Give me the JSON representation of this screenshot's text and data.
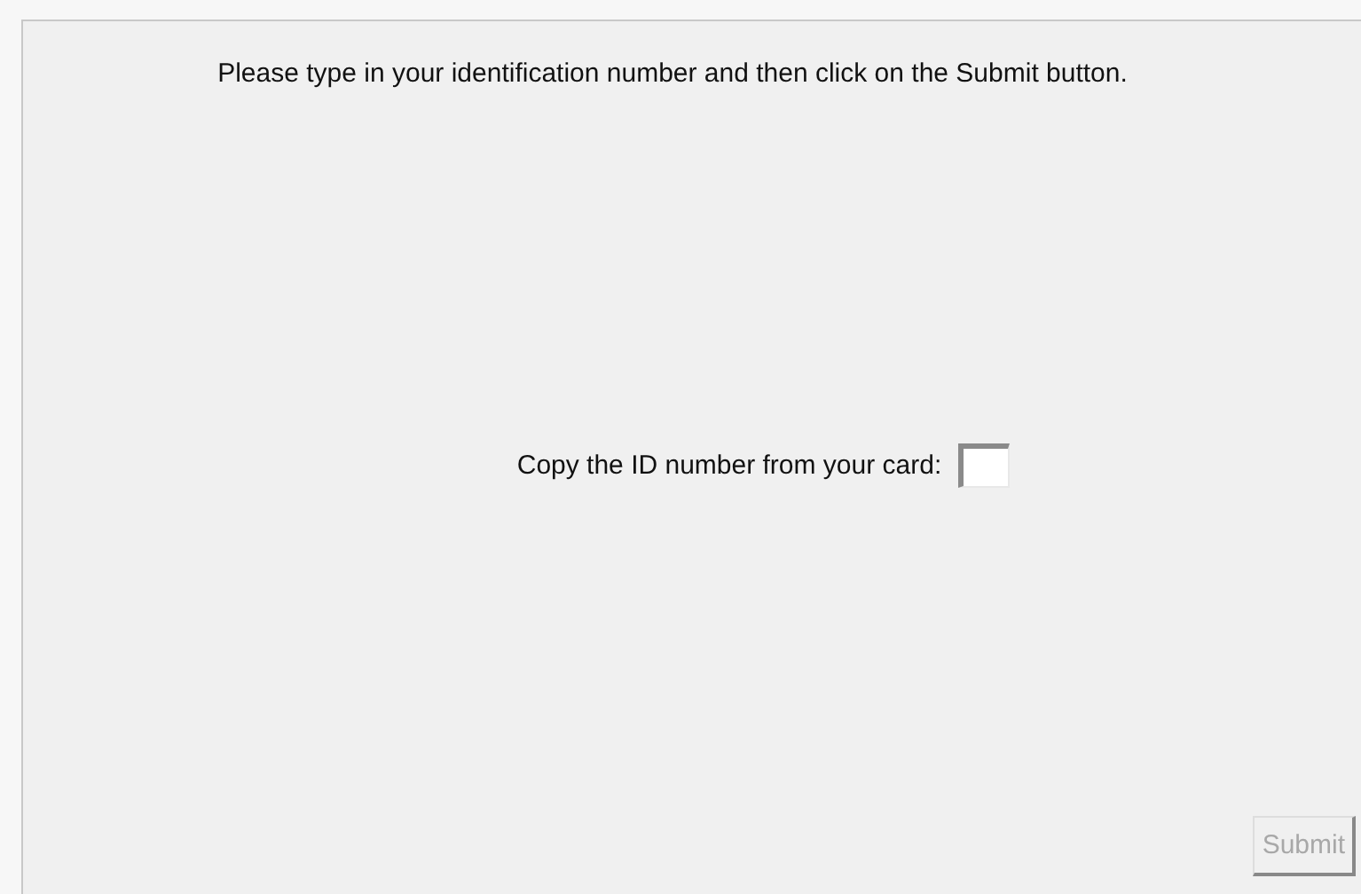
{
  "instruction": "Please type in your identification number and then click on the Submit button.",
  "id_label": "Copy the ID number from your card:",
  "submit_button": {
    "label": "Submit",
    "disabled": true
  }
}
